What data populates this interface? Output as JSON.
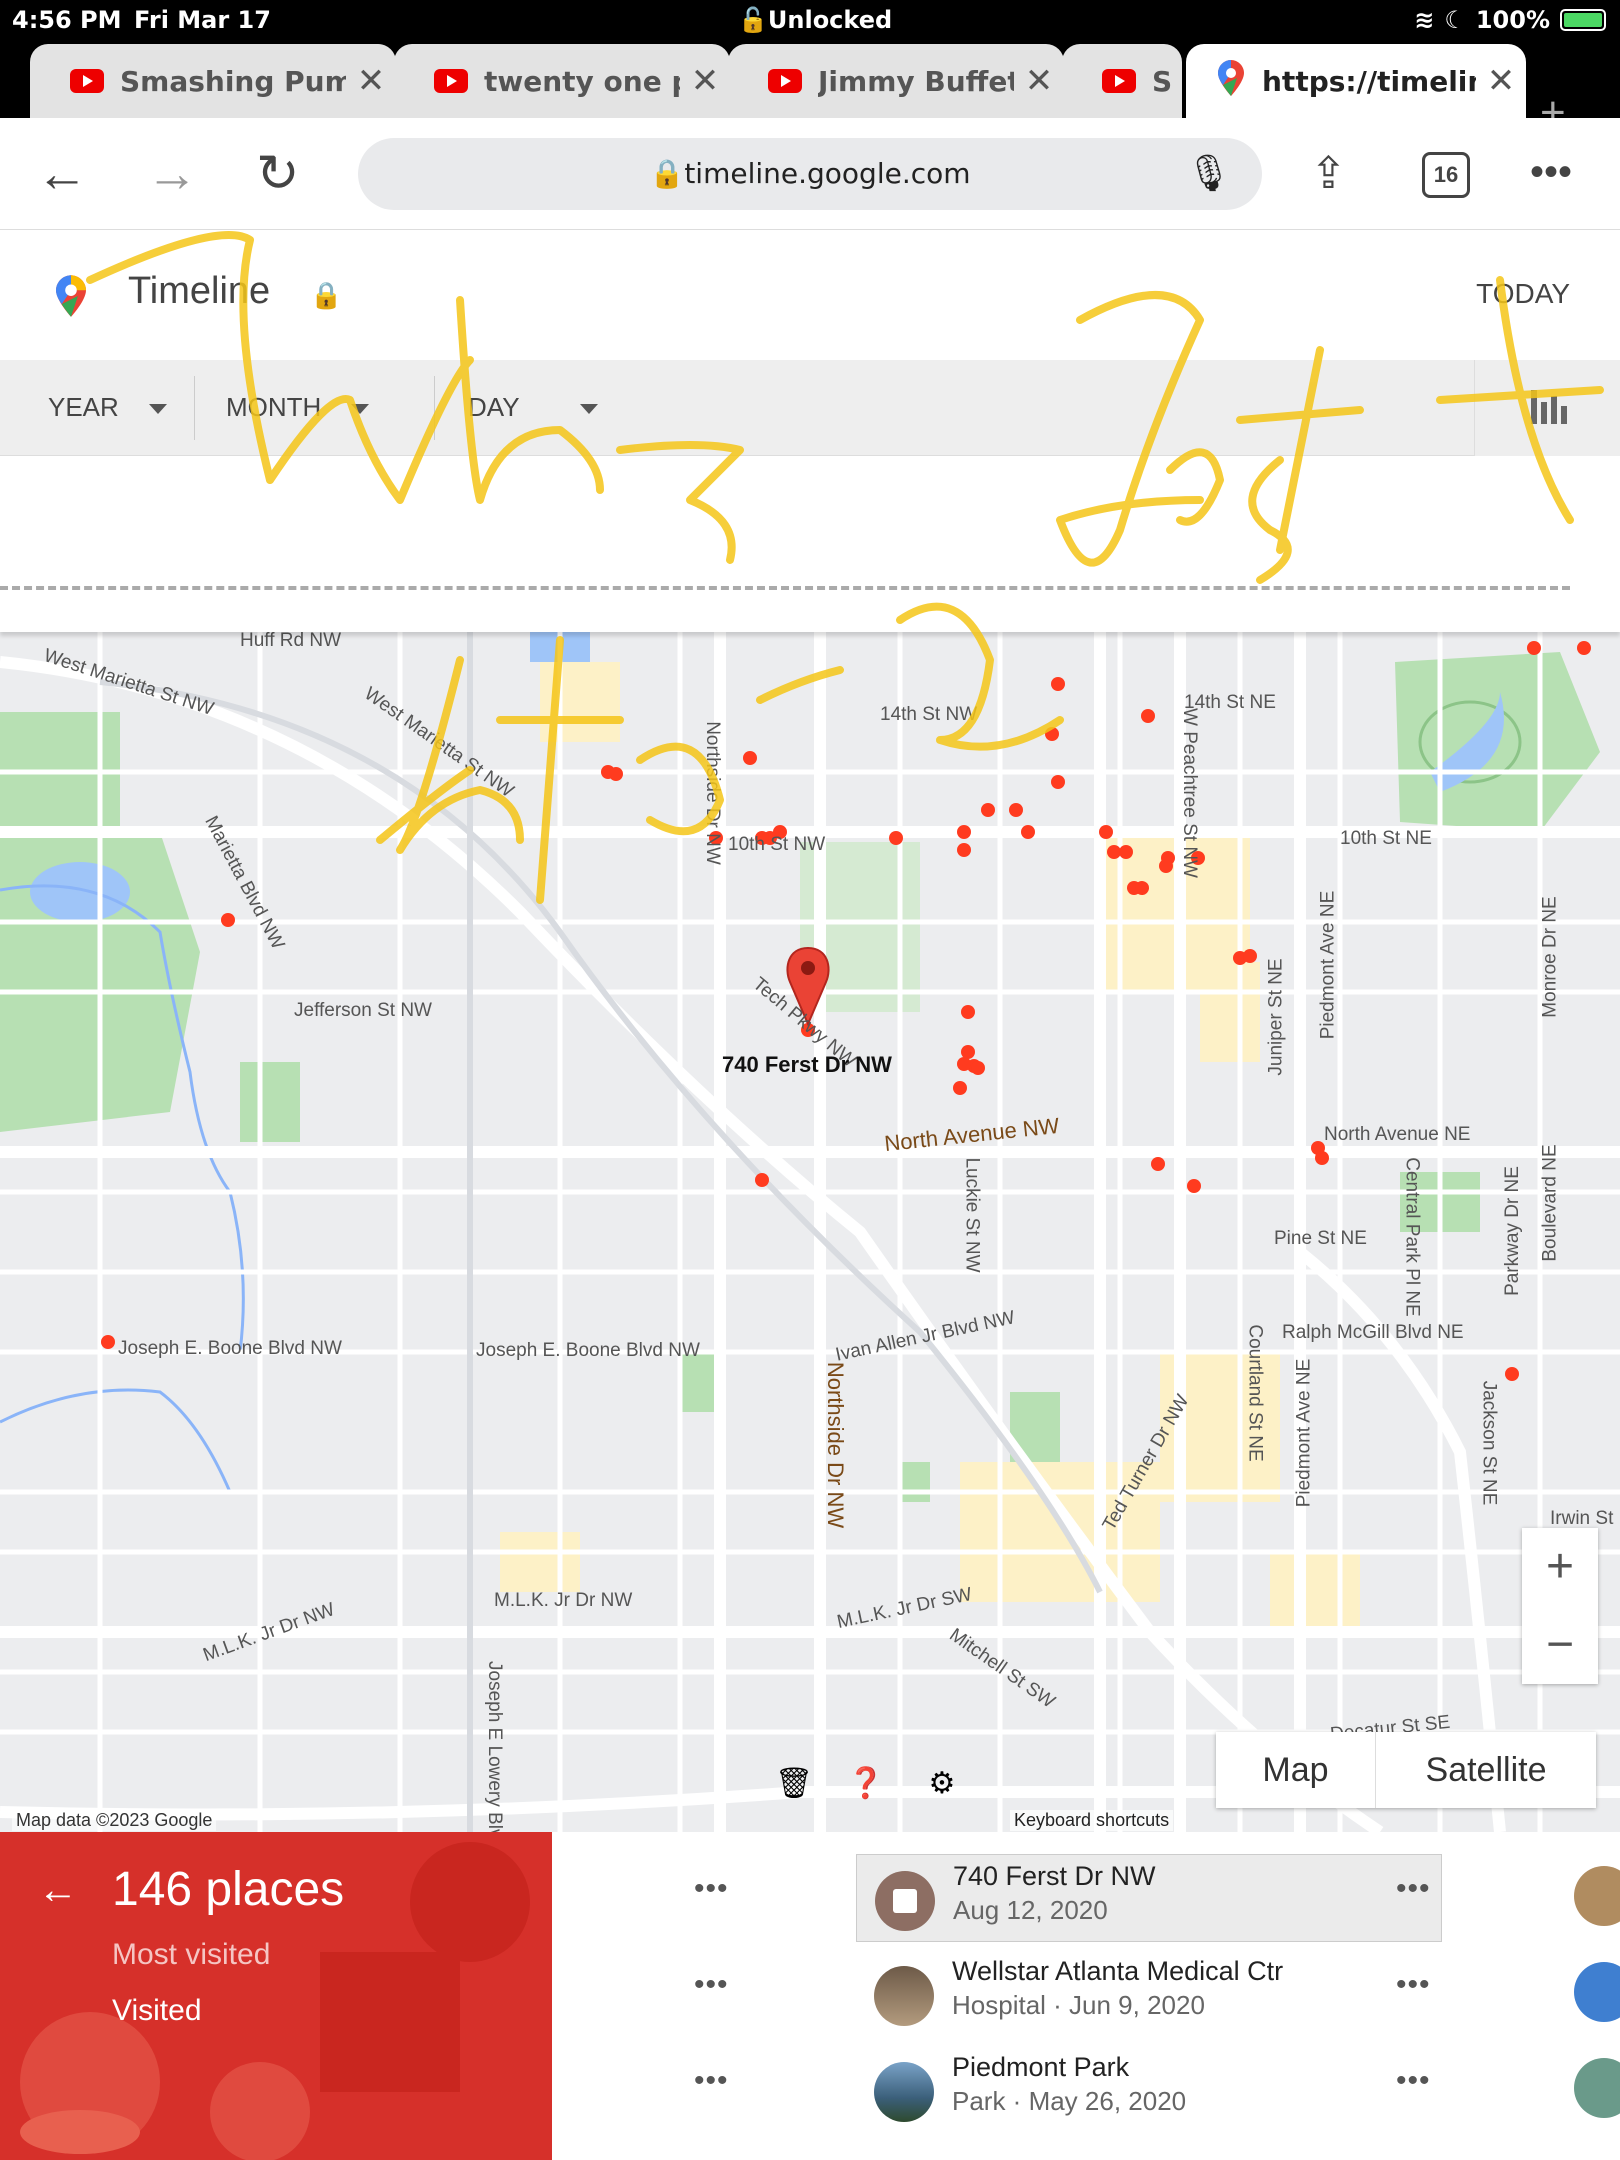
{
  "status_bar": {
    "time": "4:56 PM",
    "date": "Fri Mar 17",
    "lock_status": "Unlocked",
    "battery": "100%"
  },
  "tabs": [
    {
      "label": "Smashing Pumpkins",
      "icon": "youtube-icon"
    },
    {
      "label": "twenty one pilots",
      "icon": "youtube-icon"
    },
    {
      "label": "Jimmy Buffett",
      "icon": "youtube-icon"
    },
    {
      "label": "S",
      "icon": "youtube-icon"
    },
    {
      "label": "https://timeline.google.com",
      "icon": "maps-pin-icon",
      "active": true
    }
  ],
  "browser": {
    "url": "timeline.google.com",
    "tab_count": "16"
  },
  "timeline": {
    "title": "Timeline",
    "today_label": "TODAY"
  },
  "filters": {
    "year": "YEAR",
    "month": "MONTH",
    "day": "DAY"
  },
  "map": {
    "marker_label": "740 Ferst Dr NW",
    "attribution": "Map data ©2023 Google",
    "keyboard_shortcuts": "Keyboard shortcuts",
    "map_type": {
      "map": "Map",
      "satellite": "Satellite"
    },
    "zoom_in": "+",
    "zoom_out": "−",
    "streets": [
      "Huff Rd NW",
      "West Marietta St NW",
      "West Marietta St NW",
      "Marietta Blvd NW",
      "Jefferson St NW",
      "Northside Dr NW",
      "10th St NW",
      "14th St NW",
      "14th St NE",
      "10th St NE",
      "W Peachtree St NW",
      "Tech Pkwy NW",
      "North Avenue NW",
      "Luckie St NW",
      "Juniper St NE",
      "Piedmont Ave NE",
      "Monroe Dr NE",
      "North Avenue NE",
      "Central Park Pl NE",
      "Parkway Dr NE",
      "Boulevard NE",
      "Pine St NE",
      "Ralph McGill Blvd NE",
      "Courtland St NE",
      "Ivan Allen Jr Blvd NW",
      "Joseph E. Boone Blvd NW",
      "Joseph E. Boone Blvd NW",
      "Northside Dr NW",
      "Ted Turner Dr NW",
      "Piedmont Ave NE",
      "Jackson St NE",
      "Irwin St",
      "M.L.K. Jr Dr NW",
      "M.L.K. Jr Dr NW",
      "M.L.K. Jr Dr SW",
      "Mitchell St SW",
      "Joseph E Lowery Blvd",
      "Decatur St SE"
    ]
  },
  "places_panel": {
    "count": "146 places",
    "most_visited": "Most visited",
    "visited": "Visited"
  },
  "places": [
    {
      "name": "740 Ferst Dr NW",
      "detail": "Aug 12, 2020",
      "icon": "stop-icon"
    },
    {
      "name": "Wellstar Atlanta Medical Ctr",
      "detail": "Hospital · Jun 9, 2020",
      "icon": "hospital-photo"
    },
    {
      "name": "Piedmont Park",
      "detail": "Park · May 26, 2020",
      "icon": "park-photo"
    }
  ],
  "annotation": {
    "color": "#f5c518"
  },
  "colors": {
    "accent_red": "#d6302a",
    "dot_red": "#ff3b1f",
    "park_green": "#b7e0b3"
  }
}
